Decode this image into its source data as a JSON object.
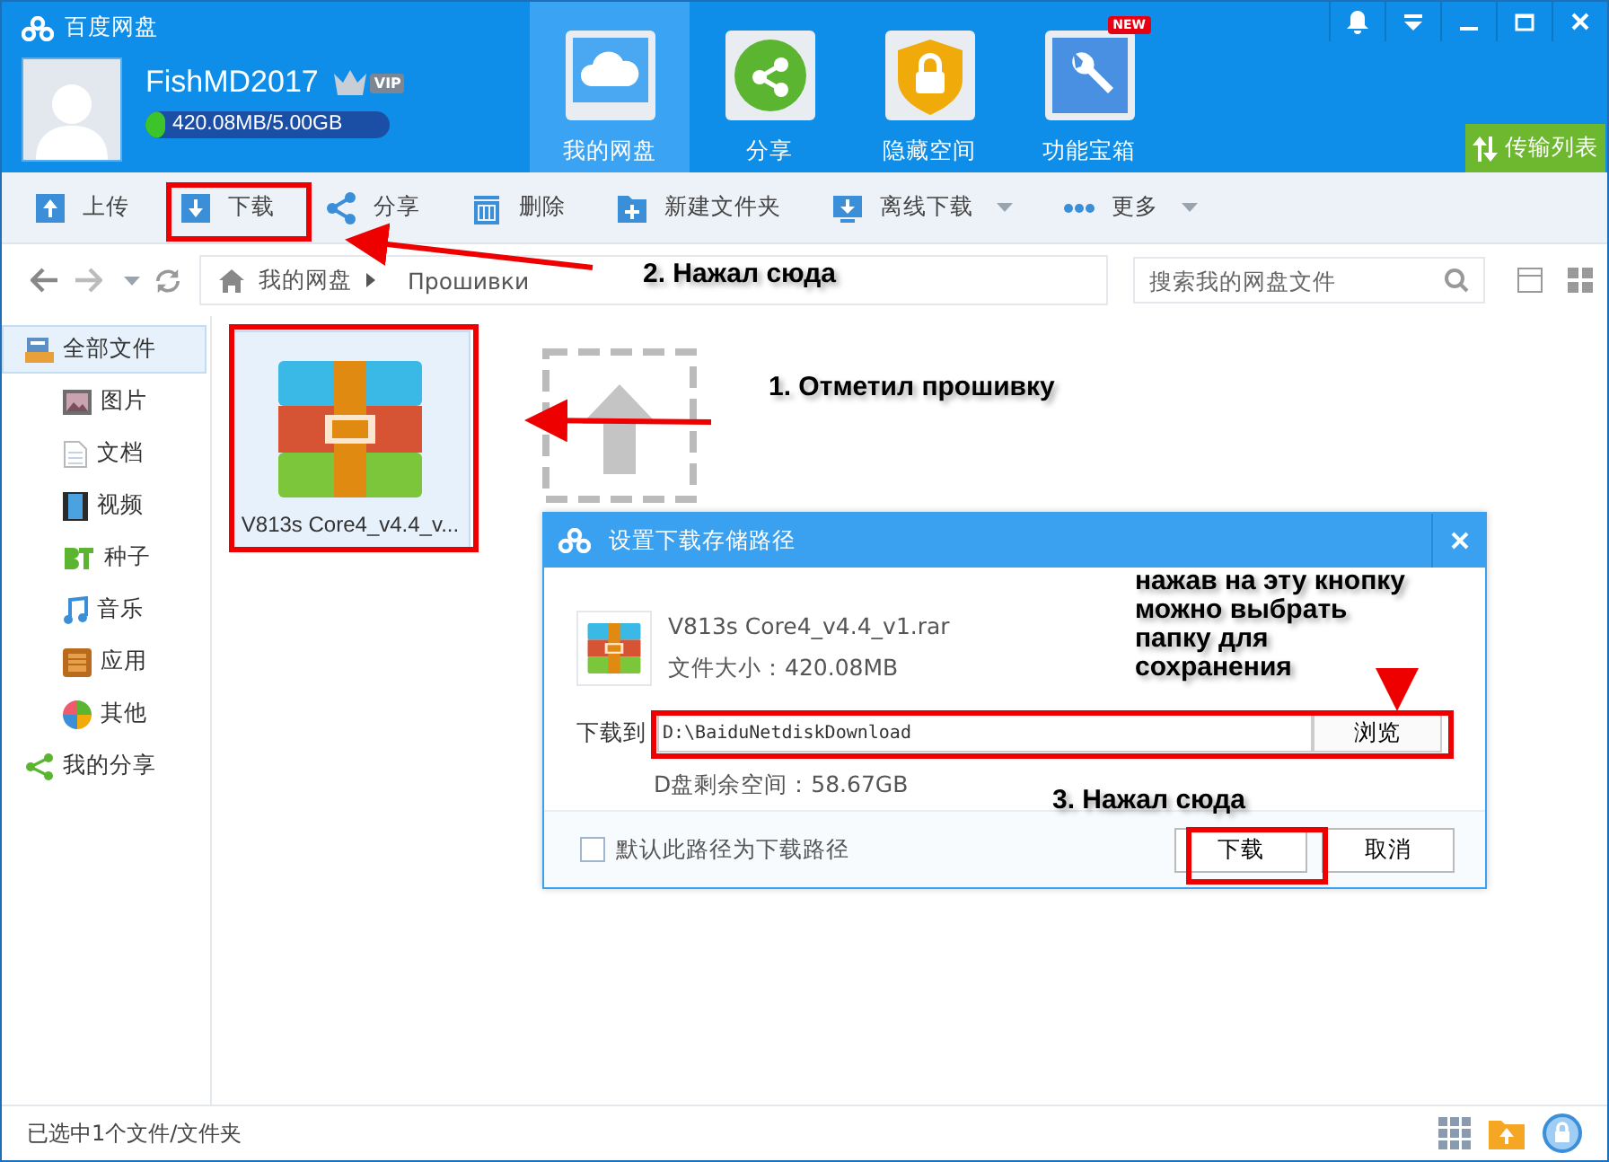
{
  "app": {
    "title": "百度网盘"
  },
  "user": {
    "name": "FishMD2017",
    "vip": "VIP",
    "storage": "420.08MB/5.00GB",
    "level": 0.08
  },
  "nav_tabs": [
    {
      "label": "我的网盘",
      "kind": "cloud",
      "selected": true
    },
    {
      "label": "分享",
      "kind": "share",
      "selected": false
    },
    {
      "label": "隐藏空间",
      "kind": "lock",
      "selected": false
    },
    {
      "label": "功能宝箱",
      "kind": "tools",
      "selected": false,
      "badge": "NEW"
    }
  ],
  "transfer_button": "传输列表",
  "toolbar": [
    {
      "label": "上传",
      "kind": "upload",
      "dropdown": false
    },
    {
      "label": "下载",
      "kind": "download",
      "dropdown": false
    },
    {
      "label": "分享",
      "kind": "share",
      "dropdown": false
    },
    {
      "label": "删除",
      "kind": "delete",
      "dropdown": false
    },
    {
      "label": "新建文件夹",
      "kind": "folder",
      "dropdown": false
    },
    {
      "label": "离线下载",
      "kind": "offline",
      "dropdown": true
    },
    {
      "label": "更多",
      "kind": "more",
      "dropdown": true
    }
  ],
  "breadcrumb": [
    "我的网盘",
    "Прошивки"
  ],
  "search": {
    "placeholder": "搜索我的网盘文件"
  },
  "sidebar": [
    {
      "label": "全部文件",
      "kind": "all",
      "selected": true,
      "children": [
        {
          "label": "图片",
          "kind": "image",
          "selected": false
        },
        {
          "label": "文档",
          "kind": "doc",
          "selected": false
        },
        {
          "label": "视频",
          "kind": "video",
          "selected": false
        },
        {
          "label": "种子",
          "kind": "bt",
          "selected": false
        },
        {
          "label": "音乐",
          "kind": "music",
          "selected": false
        },
        {
          "label": "应用",
          "kind": "app",
          "selected": false
        },
        {
          "label": "其他",
          "kind": "other",
          "selected": false
        }
      ]
    },
    {
      "label": "我的分享",
      "kind": "share",
      "selected": false
    }
  ],
  "files": [
    {
      "kind": "archive",
      "name": "V813s Core4_v4.4_v...",
      "selected": true
    },
    {
      "kind": "upload"
    }
  ],
  "dialog": {
    "title": "设置下载存储路径",
    "file_name": "V813s Core4_v4.4_v1.rar",
    "file_size": "文件大小：420.08MB",
    "path_label": "下载到",
    "path": "D:\\BaiduNetdiskDownload",
    "browse": "浏览",
    "free_space": "D盘剩余空间：58.67GB",
    "default_path": {
      "label": "默认此路径为下载路径",
      "checked": false
    },
    "buttons": [
      "下载",
      "取消"
    ]
  },
  "annotations": [
    "1. Отметил прошивку",
    "2. Нажал сюда",
    "нажав на эту кнопку\nможно выбрать\nпапку для\nсохранения",
    "3. Нажал сюда"
  ],
  "status_bar": "已选中1个文件/文件夹"
}
